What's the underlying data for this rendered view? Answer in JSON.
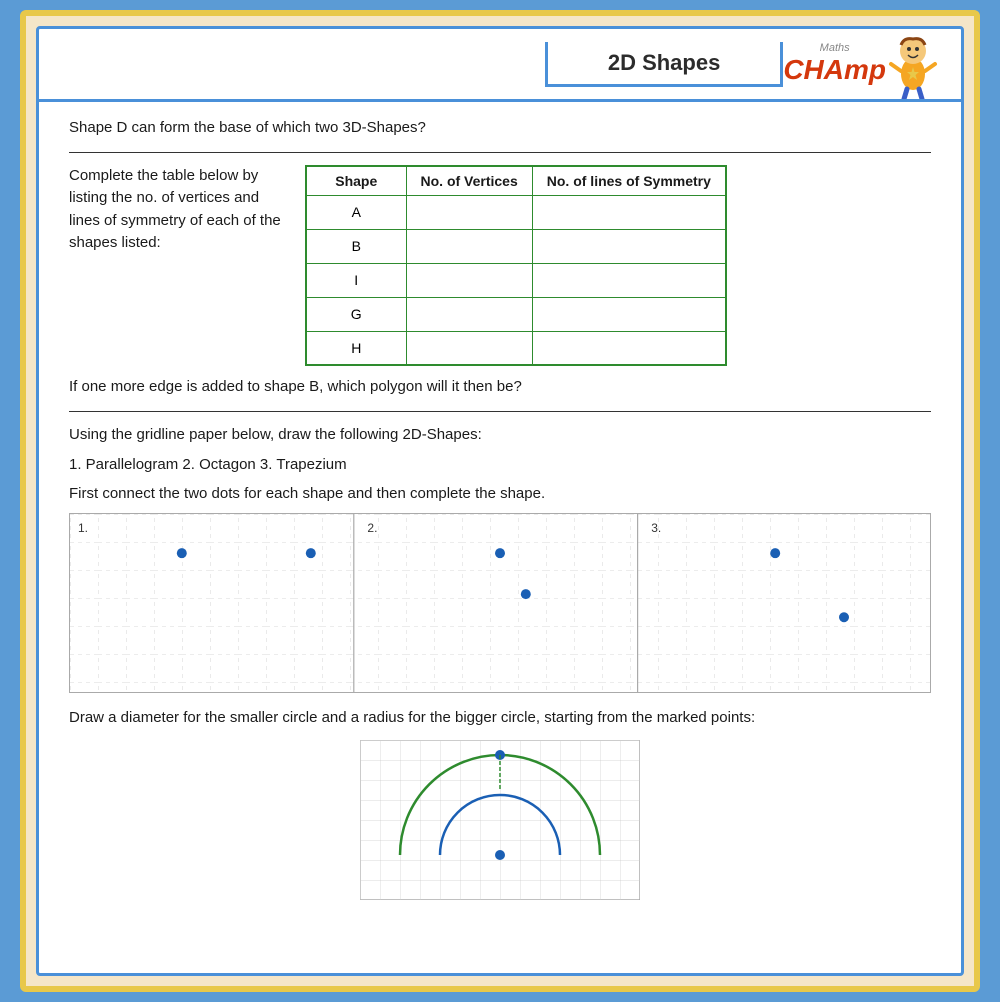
{
  "header": {
    "title": "2D Shapes",
    "champ": "CHAmp"
  },
  "questions": {
    "q1": "Shape D can form the base of which two 3D-Shapes?",
    "q2_intro": "Complete the table below by listing the no. of vertices and lines of symmetry of each of the shapes listed:",
    "q3": "If one more edge is added to shape B, which polygon will it then be?",
    "q4_intro": "Using the gridline paper below, draw the following 2D-Shapes:",
    "q4_shapes": "1.    Parallelogram                  2.    Octagon                  3.    Trapezium",
    "q4_instruction": "First connect the two dots for each shape and then complete the shape.",
    "q5": "Draw a diameter for the smaller circle and a radius for the bigger circle, starting from the marked points:"
  },
  "table": {
    "headers": [
      "Shape",
      "No. of Vertices",
      "No. of lines of Symmetry"
    ],
    "rows": [
      {
        "shape": "A",
        "vertices": "",
        "symmetry": ""
      },
      {
        "shape": "B",
        "vertices": "",
        "symmetry": ""
      },
      {
        "shape": "I",
        "vertices": "",
        "symmetry": ""
      },
      {
        "shape": "G",
        "vertices": "",
        "symmetry": ""
      },
      {
        "shape": "H",
        "vertices": "",
        "symmetry": ""
      }
    ]
  },
  "grid_labels": {
    "s1": "1.",
    "s2": "2.",
    "s3": "3."
  },
  "colors": {
    "border": "#4a90d9",
    "table_border": "#2e8b2e",
    "dot": "#1a5fb4",
    "circle_green": "#2e8b2e",
    "circle_blue": "#1a5fb4",
    "accent": "#e8c84a"
  }
}
